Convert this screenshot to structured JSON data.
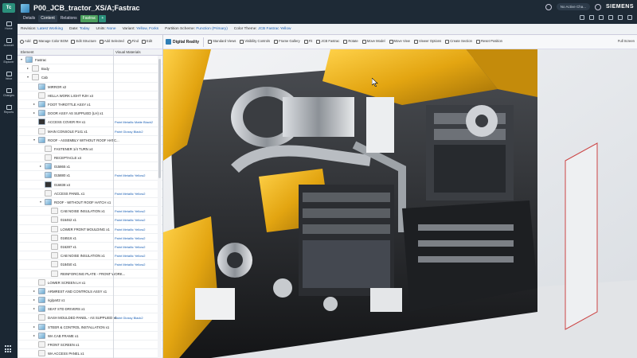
{
  "rail": {
    "logo": "Tc",
    "items": [
      {
        "label": "Home",
        "icon": "home-icon"
      },
      {
        "label": "Account",
        "icon": "account-icon"
      },
      {
        "label": "Explorer",
        "icon": "explorer-icon"
      },
      {
        "label": "Inbox",
        "icon": "inbox-icon"
      },
      {
        "label": "Changes",
        "icon": "changes-icon"
      },
      {
        "label": "Reports",
        "icon": "reports-icon"
      }
    ]
  },
  "header": {
    "title": "P00_JCB_tractor_XS/A;Fastrac",
    "tabs": [
      "Details",
      "Content",
      "Relations"
    ],
    "active_tab": "Content",
    "extra_tab": "Fastrac",
    "status_chip": "No Active Cha...",
    "brand": "SIEMENS"
  },
  "revision_bar": {
    "revision_label": "Revision:",
    "revision_value": "Latest Working",
    "date_label": "Date:",
    "date_value": "Today",
    "units_label": "Units:",
    "units_value": "None",
    "variant_label": "Variant:",
    "variant_value": "Yellow, Forks",
    "partition_label": "Partition Scheme:",
    "partition_value": "Function (Primary)",
    "color_label": "Color Theme:",
    "color_value": "JCB Fastrac Yellow"
  },
  "tree_toolbar": [
    "Add",
    "Manage Color BOM",
    "Edit Structure",
    "Add Selected",
    "Find",
    "Edit"
  ],
  "tree_header": {
    "element": "Element",
    "material": "Visual Materials"
  },
  "tree_rows": [
    {
      "indent": 0,
      "arrow": "▾",
      "thumb": "cube",
      "label": "Fastrac",
      "material": ""
    },
    {
      "indent": 1,
      "arrow": "▸",
      "thumb": "part",
      "label": "Body",
      "material": ""
    },
    {
      "indent": 1,
      "arrow": "▾",
      "thumb": "part",
      "label": "Cab",
      "material": ""
    },
    {
      "indent": 2,
      "arrow": "",
      "thumb": "cube",
      "label": "MIRROR x2",
      "material": ""
    },
    {
      "indent": 2,
      "arrow": "",
      "thumb": "part",
      "label": "HELLA WORK LIGHT RJH x4",
      "material": ""
    },
    {
      "indent": 2,
      "arrow": "▸",
      "thumb": "cube",
      "label": "FOOT THROTTLE ASSY x1",
      "material": ""
    },
    {
      "indent": 2,
      "arrow": "▸",
      "thumb": "cube",
      "label": "DOOR ASSY AS SUPPLIED (LH) x1",
      "material": ""
    },
    {
      "indent": 2,
      "arrow": "",
      "thumb": "dark",
      "label": "ACCESS COVER RH x1",
      "material": "Paint Metallic Matte Black2"
    },
    {
      "indent": 2,
      "arrow": "",
      "thumb": "part",
      "label": "MAIN CONSOLE P141 x1",
      "material": "Paint Glossy Black2"
    },
    {
      "indent": 2,
      "arrow": "▾",
      "thumb": "cube",
      "label": "ROOF - ASSEMBLY WITHOUT ROOF HATC...",
      "material": ""
    },
    {
      "indent": 3,
      "arrow": "",
      "thumb": "part",
      "label": "FASTENER 1/4 TURN x4",
      "material": ""
    },
    {
      "indent": 3,
      "arrow": "",
      "thumb": "part",
      "label": "RECEPTACLE x4",
      "material": ""
    },
    {
      "indent": 3,
      "arrow": "▸",
      "thumb": "cube",
      "label": "015865 x1",
      "material": ""
    },
    {
      "indent": 3,
      "arrow": "",
      "thumb": "cube",
      "label": "015880 x1",
      "material": "Paint Metallic Yellow2"
    },
    {
      "indent": 3,
      "arrow": "",
      "thumb": "dark",
      "label": "016838 x4",
      "material": ""
    },
    {
      "indent": 3,
      "arrow": "",
      "thumb": "part",
      "label": "ACCESS PANEL x1",
      "material": "Paint Metallic Yellow2"
    },
    {
      "indent": 3,
      "arrow": "▾",
      "thumb": "cube",
      "label": "ROOF - WITHOUT ROOF HATCH x1",
      "material": ""
    },
    {
      "indent": 4,
      "arrow": "",
      "thumb": "part",
      "label": "CAB NOISE INSULATION x1",
      "material": "Paint Metallic Yellow2"
    },
    {
      "indent": 4,
      "arrow": "",
      "thumb": "part",
      "label": "016462 x1",
      "material": "Paint Metallic Yellow2"
    },
    {
      "indent": 4,
      "arrow": "",
      "thumb": "part",
      "label": "LOWER FRONT MOULDING x1",
      "material": "Paint Metallic Yellow2"
    },
    {
      "indent": 4,
      "arrow": "",
      "thumb": "part",
      "label": "016516 x1",
      "material": "Paint Metallic Yellow2"
    },
    {
      "indent": 4,
      "arrow": "",
      "thumb": "part",
      "label": "016287 x1",
      "material": "Paint Metallic Yellow2"
    },
    {
      "indent": 4,
      "arrow": "",
      "thumb": "part",
      "label": "CAB NOISE INSULATION x1",
      "material": "Paint Metallic Yellow2"
    },
    {
      "indent": 4,
      "arrow": "",
      "thumb": "part",
      "label": "018450 x1",
      "material": "Paint Metallic Yellow2"
    },
    {
      "indent": 4,
      "arrow": "",
      "thumb": "part",
      "label": "REINFORCING PLATE - FRONT WORK...",
      "material": ""
    },
    {
      "indent": 2,
      "arrow": "",
      "thumb": "part",
      "label": "LOWER SCREEN LH x1",
      "material": ""
    },
    {
      "indent": 2,
      "arrow": "▸",
      "thumb": "cube",
      "label": "ARMREST AND CONTROLS ASSY x1",
      "material": ""
    },
    {
      "indent": 2,
      "arrow": "▸",
      "thumb": "cube",
      "label": "rig/part2 x1",
      "material": ""
    },
    {
      "indent": 2,
      "arrow": "▸",
      "thumb": "cube",
      "label": "SEAT STD DRIVERS x1",
      "material": ""
    },
    {
      "indent": 2,
      "arrow": "",
      "thumb": "part",
      "label": "DASH MOULDED PANEL - AS SUPPLIED x1",
      "material": "Paint Glossy Black2"
    },
    {
      "indent": 2,
      "arrow": "▸",
      "thumb": "cube",
      "label": "STEER & CONTROL INSTALLATION x1",
      "material": ""
    },
    {
      "indent": 2,
      "arrow": "▸",
      "thumb": "cube",
      "label": "WA CAB FRAME x1",
      "material": ""
    },
    {
      "indent": 2,
      "arrow": "",
      "thumb": "part",
      "label": "FRONT SCREEN x1",
      "material": ""
    },
    {
      "indent": 2,
      "arrow": "",
      "thumb": "part",
      "label": "WA ACCESS PANEL x1",
      "material": ""
    }
  ],
  "viewer_toolbar": {
    "mode": "Digital Reality",
    "tools": [
      "Standard Views",
      "Visibility Controls",
      "Frame Gallery",
      "Fit",
      "JCB Fastrac",
      "Rotate",
      "Move Model",
      "Move View",
      "Viewer Options",
      "Create Section",
      "Reset Position"
    ],
    "right_tools": [
      "Full Screen"
    ]
  },
  "colors": {
    "rail": "#1b2733",
    "accent": "#2a8f7b",
    "link": "#1a5fb4",
    "yellow": "#f2b51c"
  }
}
